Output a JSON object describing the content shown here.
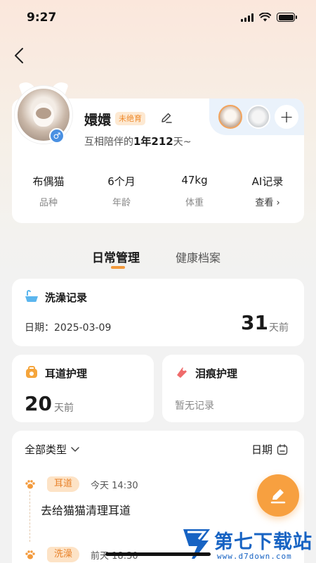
{
  "status_bar": {
    "time": "9:27"
  },
  "profile": {
    "name": "嬛嬛",
    "status_tag": "未绝育",
    "together_prefix": "互相陪伴的",
    "together_value": "1年212",
    "together_suffix": "天~",
    "gender_symbol": "♂",
    "stats": [
      {
        "value": "布偶猫",
        "label": "品种"
      },
      {
        "value": "6个月",
        "label": "年龄"
      },
      {
        "value": "47kg",
        "label": "体重"
      },
      {
        "value": "AI记录",
        "label": "查看 ›"
      }
    ],
    "add_pet_label": "+"
  },
  "tabs": [
    {
      "label": "日常管理",
      "active": true
    },
    {
      "label": "健康档案",
      "active": false
    }
  ],
  "bath": {
    "title": "洗澡记录",
    "date": "日期：2025-03-09",
    "days": "31",
    "days_unit": "天前"
  },
  "ear": {
    "title": "耳道护理",
    "days": "20",
    "days_unit": "天前"
  },
  "tear": {
    "title": "泪痕护理",
    "empty": "暂无记录"
  },
  "records": {
    "filter_label": "全部类型",
    "date_label": "日期",
    "items": [
      {
        "tag": "耳道",
        "time": "今天 14:30",
        "desc": "去给猫猫清理耳道"
      },
      {
        "tag": "洗澡",
        "time": "前天 18:30"
      }
    ]
  },
  "watermark": {
    "title": "第七下载站",
    "url": "www.d7down.com"
  },
  "colors": {
    "accent": "#f39a3c",
    "tag_bg": "#fde3c6",
    "gender": "#4a90e2",
    "watermark": "#1763c3"
  }
}
